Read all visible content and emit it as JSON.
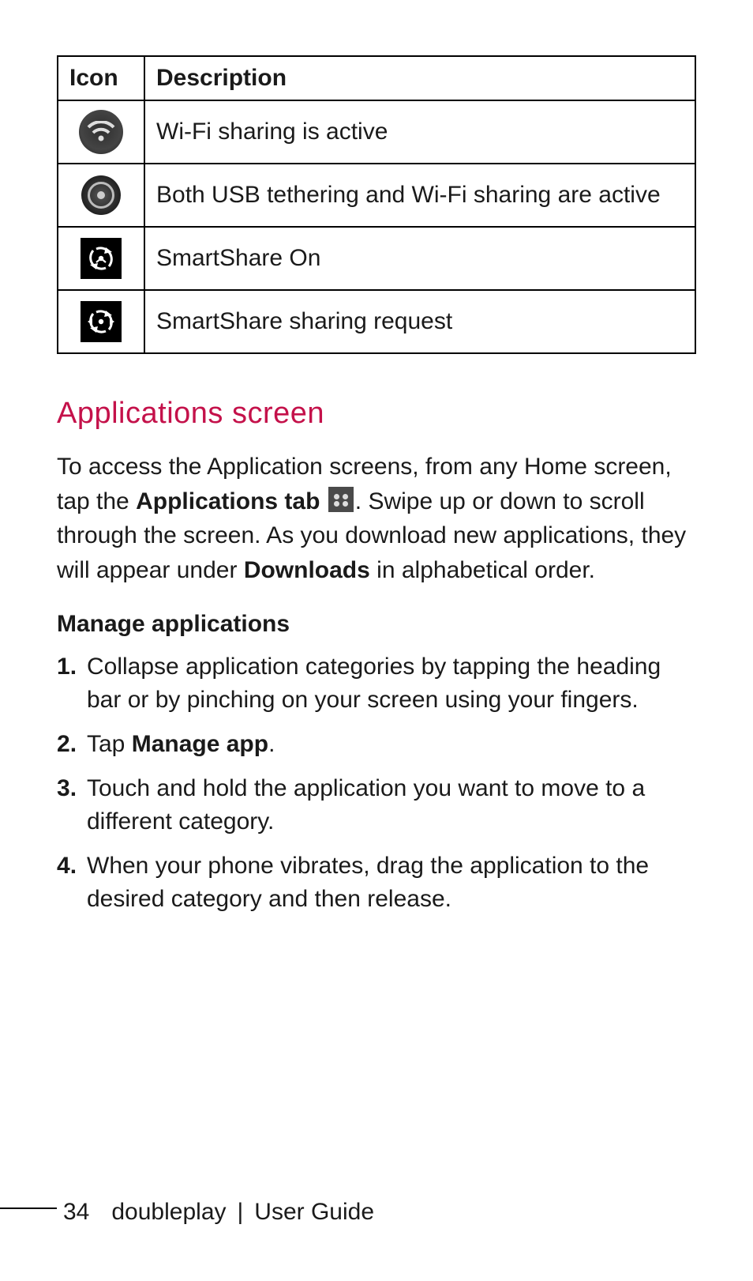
{
  "table": {
    "headers": {
      "icon": "Icon",
      "description": "Description"
    },
    "rows": [
      {
        "icon_name": "wifi-sharing-icon",
        "description": "Wi-Fi sharing is active"
      },
      {
        "icon_name": "usb-wifi-both-icon",
        "description": "Both USB tethering and Wi-Fi sharing are active"
      },
      {
        "icon_name": "smartshare-on-icon",
        "description": "SmartShare On"
      },
      {
        "icon_name": "smartshare-request-icon",
        "description": "SmartShare sharing request"
      }
    ]
  },
  "section": {
    "heading": "Applications screen",
    "para_before_bold1": "To access the Application screens, from any Home screen, tap the ",
    "bold1": "Applications tab",
    "para_after_icon": ". Swipe up or down to scroll through the screen. As you download new applications, they will appear under ",
    "bold2": "Downloads",
    "para_tail": " in alphabetical order."
  },
  "subsection": {
    "heading": "Manage applications",
    "steps": [
      {
        "pre": "Collapse application categories by tapping the heading bar or by pinching on your screen using your fingers.",
        "bold": "",
        "post": ""
      },
      {
        "pre": "Tap ",
        "bold": "Manage app",
        "post": "."
      },
      {
        "pre": "Touch and hold the application you want to move to a different category.",
        "bold": "",
        "post": ""
      },
      {
        "pre": "When your phone vibrates, drag the application to the desired category and then release.",
        "bold": "",
        "post": ""
      }
    ]
  },
  "footer": {
    "page_number": "34",
    "product": "doubleplay",
    "separator": "|",
    "doc_title": "User Guide"
  }
}
